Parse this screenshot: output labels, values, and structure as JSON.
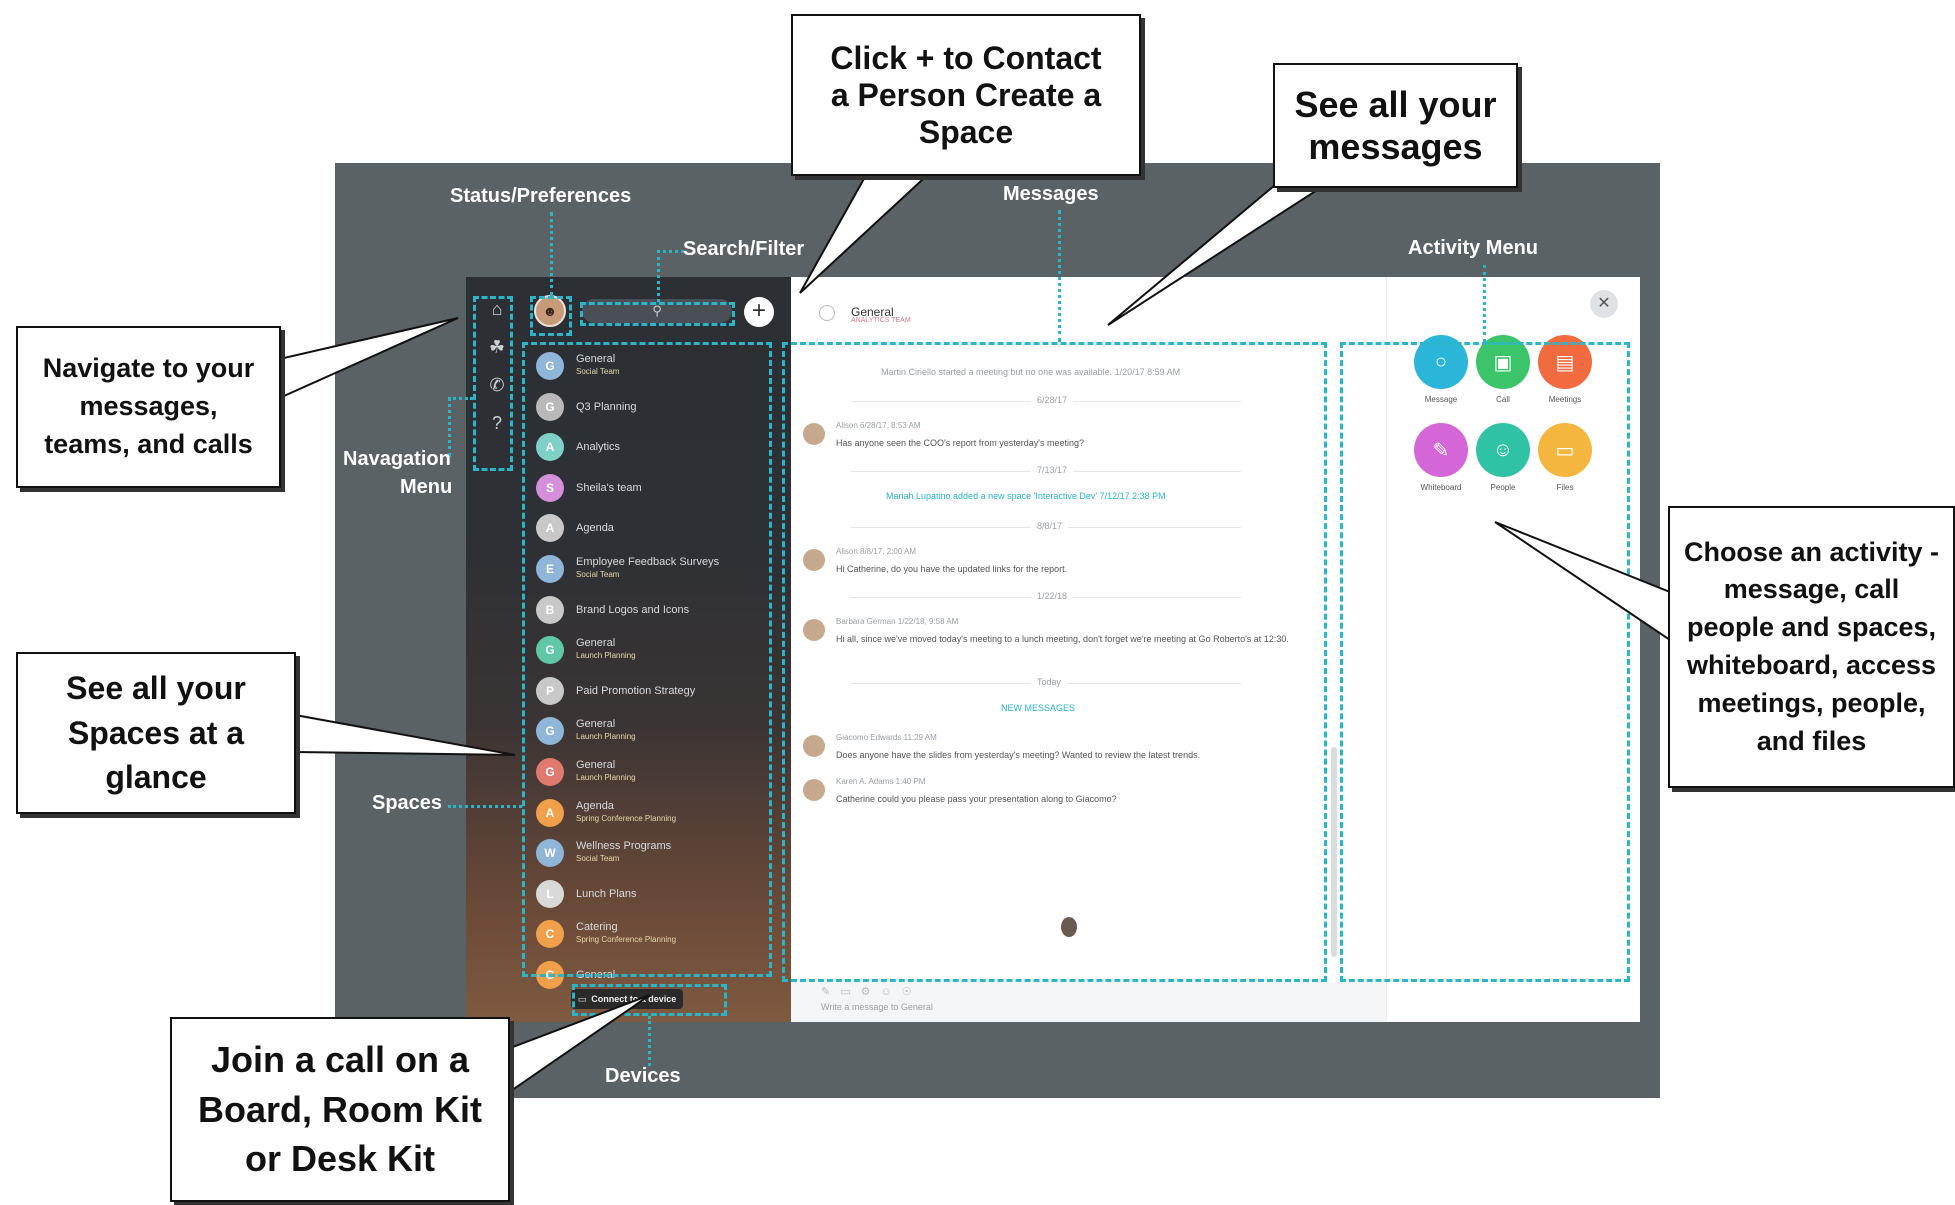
{
  "callouts": {
    "contact": "Click + to Contact a Person Create a Space",
    "messages": "See all your messages",
    "navigate": "Navigate to your messages, teams, and calls",
    "spaces": "See all your Spaces at a glance",
    "activity": "Choose an activity - message, call people and spaces, whiteboard, access meetings, people, and files",
    "join": "Join a call on a Board, Room Kit or Desk Kit"
  },
  "labels": {
    "status": "Status/Preferences",
    "search": "Search/Filter",
    "messages": "Messages",
    "activity_menu": "Activity Menu",
    "nav_menu_1": "Navagation",
    "nav_menu_2": "Menu",
    "spaces": "Spaces",
    "devices": "Devices"
  },
  "sidebar": {
    "nav_icons": [
      "home-icon",
      "teams-icon",
      "phone-icon",
      "help-icon"
    ],
    "spaces": [
      {
        "letter": "G",
        "color": "#8fb5d9",
        "name": "General",
        "sub": "Social Team"
      },
      {
        "letter": "G",
        "color": "#b9b9b9",
        "name": "Q3 Planning",
        "sub": ""
      },
      {
        "letter": "A",
        "color": "#7fd0c7",
        "name": "Analytics",
        "sub": ""
      },
      {
        "letter": "S",
        "color": "#d38fd9",
        "name": "Sheila's team",
        "sub": ""
      },
      {
        "letter": "A",
        "color": "#c8c8c8",
        "name": "Agenda",
        "sub": ""
      },
      {
        "letter": "E",
        "color": "#8fb5d9",
        "name": "Employee Feedback Surveys",
        "sub": "Social Team"
      },
      {
        "letter": "B",
        "color": "#c8c8c8",
        "name": "Brand Logos and Icons",
        "sub": ""
      },
      {
        "letter": "G",
        "color": "#5fc7a6",
        "name": "General",
        "sub": "Launch Planning"
      },
      {
        "letter": "P",
        "color": "#c8c8c8",
        "name": "Paid Promotion Strategy",
        "sub": ""
      },
      {
        "letter": "G",
        "color": "#8fb5d9",
        "name": "General",
        "sub": "Launch Planning"
      },
      {
        "letter": "G",
        "color": "#e07a6e",
        "name": "General",
        "sub": "Launch Planning"
      },
      {
        "letter": "A",
        "color": "#f0a04b",
        "name": "Agenda",
        "sub": "Spring Conference Planning"
      },
      {
        "letter": "W",
        "color": "#8fb5d9",
        "name": "Wellness Programs",
        "sub": "Social Team"
      },
      {
        "letter": "L",
        "color": "#d9d9d9",
        "name": "Lunch Plans",
        "sub": ""
      },
      {
        "letter": "C",
        "color": "#f0a04b",
        "name": "Catering",
        "sub": "Spring Conference Planning"
      },
      {
        "letter": "G",
        "color": "#f0a04b",
        "name": "General",
        "sub": ""
      }
    ],
    "device_button": "Connect to a device"
  },
  "messages": {
    "space_title": "General",
    "space_sub": "ANALYTICS TEAM",
    "items": [
      {
        "kind": "system",
        "text": "Martin Ciriello started a meeting but no one was available. 1/20/17 8:59 AM"
      },
      {
        "kind": "date",
        "text": "6/28/17"
      },
      {
        "kind": "msg",
        "author": "Alison 6/28/17, 8:53 AM",
        "text": "Has anyone seen the COO's report from yesterday's meeting?"
      },
      {
        "kind": "date",
        "text": "7/13/17"
      },
      {
        "kind": "link",
        "text": "Mariah Lupatino added a new space 'Interactive Dev' 7/12/17 2:38 PM"
      },
      {
        "kind": "date",
        "text": "8/8/17"
      },
      {
        "kind": "msg",
        "author": "Alison 8/8/17, 2:00 AM",
        "text": "Hi Catherine, do you have the updated links for the report."
      },
      {
        "kind": "date",
        "text": "1/22/18"
      },
      {
        "kind": "msg",
        "author": "Barbara German 1/22/18, 9:58 AM",
        "text": "Hi all, since we've moved today's meeting to a lunch meeting, don't forget we're meeting at Go Roberto's at 12:30."
      },
      {
        "kind": "date",
        "text": "Today"
      },
      {
        "kind": "link",
        "text": "NEW MESSAGES"
      },
      {
        "kind": "msg",
        "author": "Giacomo Edwards 11:29 AM",
        "text": "Does anyone have the slides from yesterday's meeting? Wanted to review the latest trends."
      },
      {
        "kind": "msg",
        "author": "Karen A. Adams 1:40 PM",
        "text": "Catherine could you please pass your presentation along to Giacomo?"
      }
    ],
    "composer_placeholder": "Write a message to General"
  },
  "activity": {
    "items": [
      {
        "label": "Message",
        "color": "#2bb5d8",
        "icon": "message-icon"
      },
      {
        "label": "Call",
        "color": "#3cc46a",
        "icon": "video-icon"
      },
      {
        "label": "Meetings",
        "color": "#f26a3f",
        "icon": "calendar-icon"
      },
      {
        "label": "Whiteboard",
        "color": "#d466d8",
        "icon": "pencil-icon"
      },
      {
        "label": "People",
        "color": "#2fc2a4",
        "icon": "person-icon"
      },
      {
        "label": "Files",
        "color": "#f5b640",
        "icon": "folder-icon"
      }
    ]
  }
}
